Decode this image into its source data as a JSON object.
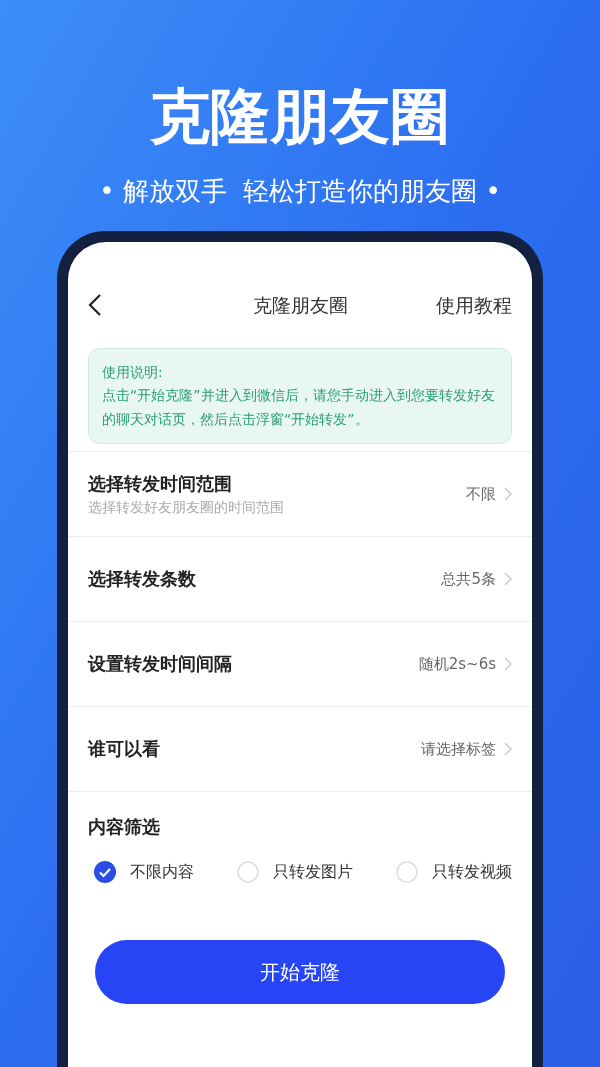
{
  "banner": {
    "title": "克隆朋友圈",
    "subtitle": "• 解放双手  轻松打造你的朋友圈 •"
  },
  "nav": {
    "title": "克隆朋友圈",
    "action": "使用教程"
  },
  "notice": {
    "heading": "使用说明:",
    "body": "点击“开始克隆”并进入到微信后，请您手动进入到您要转发好友的聊天对话页，然后点击浮窗“开始转发”。"
  },
  "settings": [
    {
      "title": "选择转发时间范围",
      "subtitle": "选择转发好友朋友圈的时间范围",
      "value": "不限"
    },
    {
      "title": "选择转发条数",
      "value": "总共5条"
    },
    {
      "title": "设置转发时间间隔",
      "value": "随机2s~6s"
    },
    {
      "title": "谁可以看",
      "value": "请选择标签"
    }
  ],
  "content_filter": {
    "title": "内容筛选",
    "options": [
      {
        "label": "不限内容",
        "selected": true
      },
      {
        "label": "只转发图片",
        "selected": false
      },
      {
        "label": "只转发视频",
        "selected": false
      }
    ]
  },
  "start_button": "开始克隆"
}
